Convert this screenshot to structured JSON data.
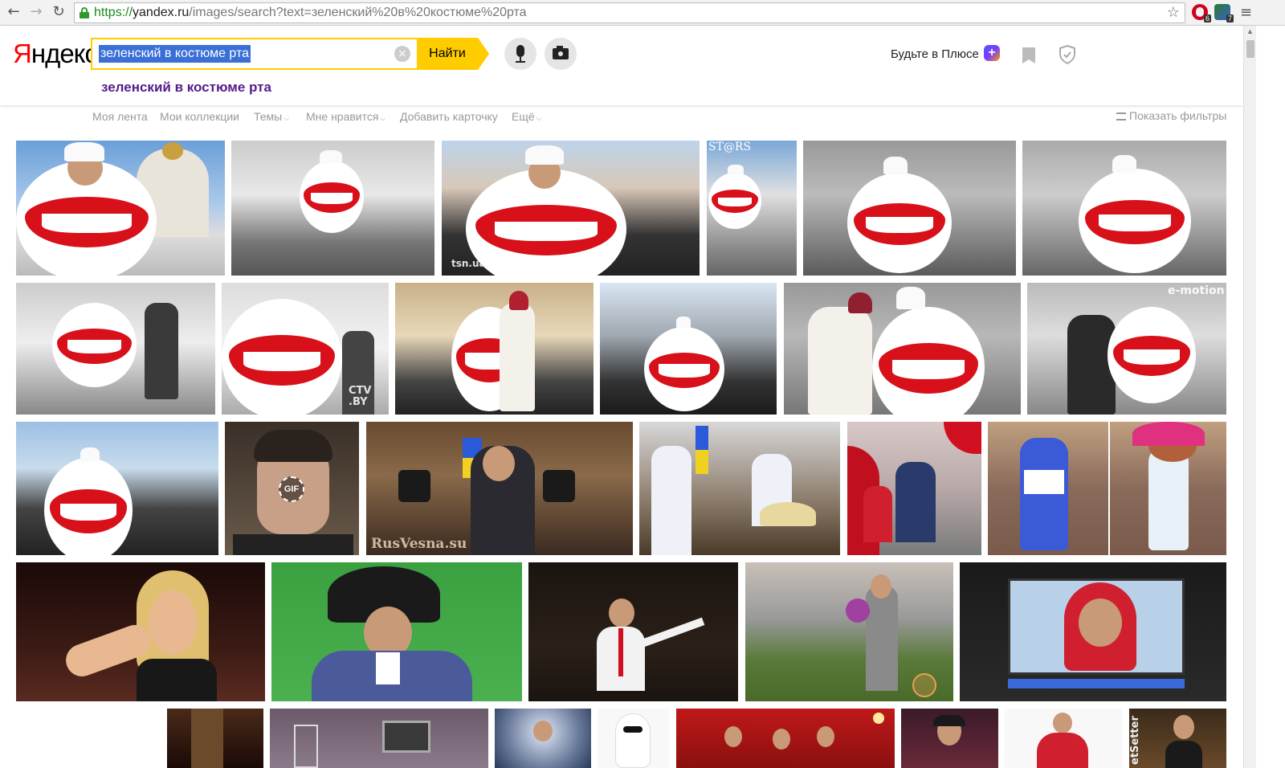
{
  "browser": {
    "url_scheme": "https://",
    "url_host": "yandex.ru",
    "url_path": "/images/search?text=зеленский%20в%20костюме%20рта",
    "ext_badge_1": "6",
    "ext_badge_2": "7"
  },
  "header": {
    "logo_first": "Я",
    "logo_rest": "ндекс",
    "search_value": "зеленский в костюме рта",
    "find_label": "Найти",
    "suggestion": "зеленский в костюме рта",
    "plus_label": "Будьте в Плюсе",
    "plus_icon": "+"
  },
  "tabs": {
    "feed": "Моя лента",
    "collections": "Мои коллекции",
    "themes": "Темы",
    "likes": "Мне нравится",
    "add_card": "Добавить карточку",
    "more": "Ещё",
    "filters": "Показать фильтры"
  },
  "watermarks": {
    "stars": "ST@RS",
    "tsn": "tsn.ua",
    "ctv": "CTV\n.BY",
    "emotion": "e-motion",
    "gif": "GIF",
    "rusvesna": "RusVesna.su",
    "setter": "etSetter"
  },
  "colors": {
    "accent_yellow": "#ffcc00",
    "logo_red": "#ff0000",
    "suggest_purple": "#551a8b",
    "selection_blue": "#3a6fd8"
  }
}
